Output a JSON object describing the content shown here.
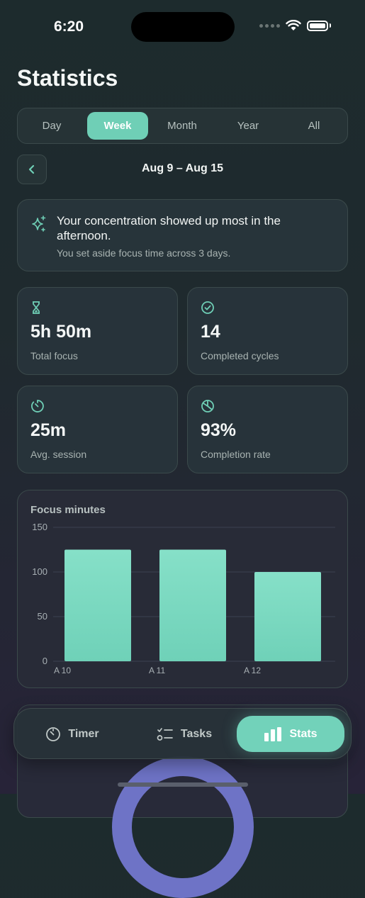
{
  "status_bar": {
    "time": "6:20"
  },
  "page": {
    "title": "Statistics"
  },
  "period_tabs": [
    {
      "label": "Day"
    },
    {
      "label": "Week"
    },
    {
      "label": "Month"
    },
    {
      "label": "Year"
    },
    {
      "label": "All"
    }
  ],
  "active_period": "Week",
  "date_range": {
    "label": "Aug 9 – Aug 15"
  },
  "insight": {
    "title": "Your concentration showed up most in the afternoon.",
    "subtitle": "You set aside focus time across 3 days."
  },
  "stats": [
    {
      "icon": "hourglass-icon",
      "value": "5h 50m",
      "label": "Total focus"
    },
    {
      "icon": "check-circle-icon",
      "value": "14",
      "label": "Completed cycles"
    },
    {
      "icon": "timer-icon",
      "value": "25m",
      "label": "Avg. session"
    },
    {
      "icon": "pie-chart-icon",
      "value": "93%",
      "label": "Completion rate"
    }
  ],
  "chart_card": {
    "title": "Focus minutes"
  },
  "chart_data": {
    "type": "bar",
    "title": "Focus minutes",
    "categories": [
      "A 10",
      "A 11",
      "A 12"
    ],
    "values": [
      125,
      125,
      100
    ],
    "ylim": [
      0,
      150
    ],
    "yticks": [
      "0",
      "50",
      "100",
      "150"
    ],
    "grid": true,
    "bar_color": "#6fd1b8"
  },
  "tab_bar": {
    "items": [
      {
        "label": "Timer",
        "icon": "timer-icon"
      },
      {
        "label": "Tasks",
        "icon": "list-icon"
      },
      {
        "label": "Stats",
        "icon": "bar-chart-icon"
      }
    ],
    "active": "Stats"
  },
  "colors": {
    "accent": "#6fcfb6",
    "background": "#1e2a2d",
    "card": "#27333a",
    "donut": "#6e73c6"
  }
}
